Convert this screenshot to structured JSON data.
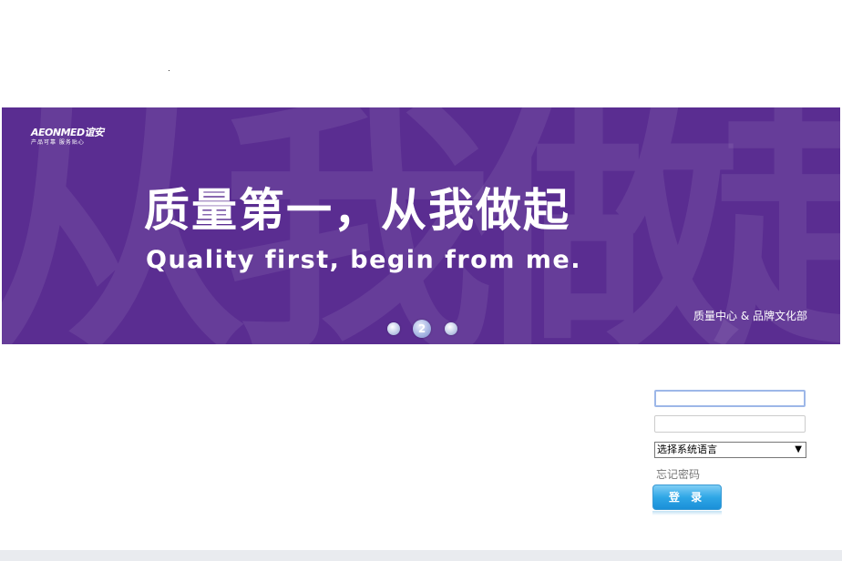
{
  "banner": {
    "logo_main": "AEONMED谊安",
    "logo_sub": "产品可靠 服务贴心",
    "watermark": "从我做起",
    "headline": "质量第一，从我做起",
    "subline": "Quality first, begin from me.",
    "department": "质量中心 & 品牌文化部",
    "background_color": "#5a2d91",
    "slider": {
      "dots": [
        "",
        "2",
        ""
      ],
      "active_index": 1
    }
  },
  "login": {
    "username_value": "",
    "password_value": "",
    "language_select": "选择系统语言",
    "forgot_password": "忘记密码",
    "login_button": "登 录"
  }
}
